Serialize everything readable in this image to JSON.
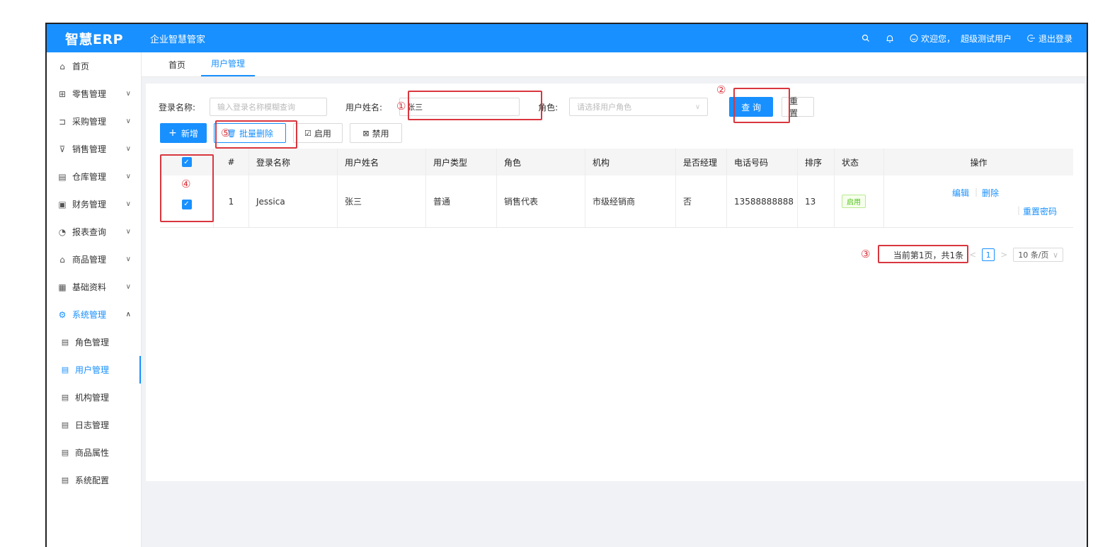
{
  "header": {
    "logo": "智慧ERP",
    "app_title": "企业智慧管家",
    "welcome": "欢迎您，",
    "user": "超级测试用户",
    "logout": "退出登录"
  },
  "sidebar": {
    "items": [
      {
        "label": "首页",
        "icon": "home-icon",
        "glyph": "⌂",
        "expand": ""
      },
      {
        "label": "零售管理",
        "icon": "gift-icon",
        "glyph": "🎁",
        "expand": "∨"
      },
      {
        "label": "采购管理",
        "icon": "purchase-icon",
        "glyph": "⊐",
        "expand": "∨"
      },
      {
        "label": "销售管理",
        "icon": "cart-icon",
        "glyph": "⊽",
        "expand": "∨"
      },
      {
        "label": "仓库管理",
        "icon": "warehouse-icon",
        "glyph": "▤",
        "expand": "∨"
      },
      {
        "label": "财务管理",
        "icon": "finance-icon",
        "glyph": "▣",
        "expand": "∨"
      },
      {
        "label": "报表查询",
        "icon": "report-icon",
        "glyph": "◔",
        "expand": "∨"
      },
      {
        "label": "商品管理",
        "icon": "goods-icon",
        "glyph": "⌂",
        "expand": "∨"
      },
      {
        "label": "基础资料",
        "icon": "basic-data-icon",
        "glyph": "▦",
        "expand": "∨"
      },
      {
        "label": "系统管理",
        "icon": "settings-icon",
        "glyph": "⚙",
        "expand": "∧"
      }
    ],
    "sub_items": [
      {
        "label": "角色管理"
      },
      {
        "label": "用户管理"
      },
      {
        "label": "机构管理"
      },
      {
        "label": "日志管理"
      },
      {
        "label": "商品属性"
      },
      {
        "label": "系统配置"
      }
    ]
  },
  "tabs": [
    {
      "label": "首页"
    },
    {
      "label": "用户管理"
    }
  ],
  "search": {
    "login_label": "登录名称:",
    "login_placeholder": "输入登录名称模糊查询",
    "username_label": "用户姓名:",
    "username_value": "张三",
    "role_label": "角色:",
    "role_placeholder": "请选择用户角色",
    "query_button": "查 询",
    "reset_button": "重 置"
  },
  "actions": {
    "add": "新增",
    "batch_delete": "批量删除",
    "enable": "启用",
    "disable": "禁用"
  },
  "table": {
    "headers": [
      "#",
      "登录名称",
      "用户姓名",
      "用户类型",
      "角色",
      "机构",
      "是否经理",
      "电话号码",
      "排序",
      "状态",
      "操作"
    ],
    "rows": [
      {
        "index": "1",
        "login": "Jessica",
        "name": "张三",
        "type": "普通",
        "role": "销售代表",
        "org": "市级经销商",
        "manager": "否",
        "phone": "13588888888",
        "sort": "13",
        "status": "启用",
        "op_edit": "编辑",
        "op_delete": "删除",
        "op_reset": "重置密码"
      }
    ]
  },
  "pagination": {
    "summary": "当前第1页，共1条",
    "current_page": "1",
    "page_size": "10 条/页"
  },
  "annotations": [
    "①",
    "②",
    "③",
    "④",
    "⑤"
  ],
  "colors": {
    "primary": "#1890ff",
    "annotation": "#d9363e",
    "status_green": "#52c41a"
  }
}
